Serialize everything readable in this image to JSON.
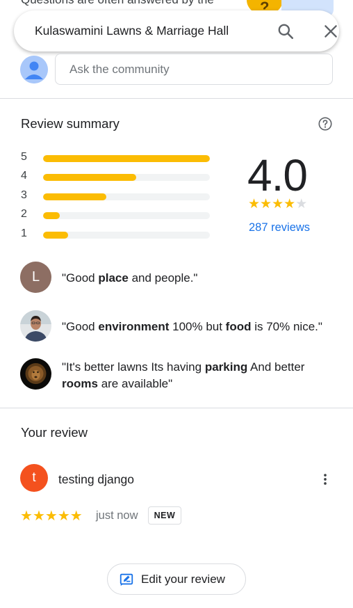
{
  "partial_top_text": "Questions are often answered by the",
  "search": {
    "query": "Kulaswamini Lawns & Marriage Hall"
  },
  "ask": {
    "placeholder": "Ask the community"
  },
  "summary": {
    "title": "Review summary",
    "rating": "4.0",
    "rating_value": 4.0,
    "reviews_link": "287 reviews",
    "distribution": [
      {
        "stars": "5",
        "fraction": 1.0
      },
      {
        "stars": "4",
        "fraction": 0.56
      },
      {
        "stars": "3",
        "fraction": 0.38
      },
      {
        "stars": "2",
        "fraction": 0.1
      },
      {
        "stars": "1",
        "fraction": 0.15
      }
    ]
  },
  "snippets": [
    {
      "initial": "L",
      "parts": [
        "\"Good ",
        "place",
        " and people.\""
      ]
    },
    {
      "parts": [
        "\"Good ",
        "environment",
        " 100% but ",
        "food",
        " is 70% nice.\""
      ]
    },
    {
      "parts": [
        "\"It's better lawns Its having ",
        "parking",
        " And better ",
        "rooms",
        " are available\""
      ]
    }
  ],
  "your_review": {
    "title": "Your review",
    "initial": "t",
    "user_name": "testing django",
    "rating": 5,
    "time": "just now",
    "badge": "NEW",
    "edit_label": "Edit your review"
  },
  "colors": {
    "star": "#fbbc04",
    "link": "#1a73e8",
    "avatar_user": "#f4511e",
    "avatar_l": "#8d6e63"
  },
  "icons": [
    "search-icon",
    "close-icon",
    "help-icon",
    "more-vert-icon",
    "edit-review-icon",
    "person-icon",
    "star-icon"
  ]
}
